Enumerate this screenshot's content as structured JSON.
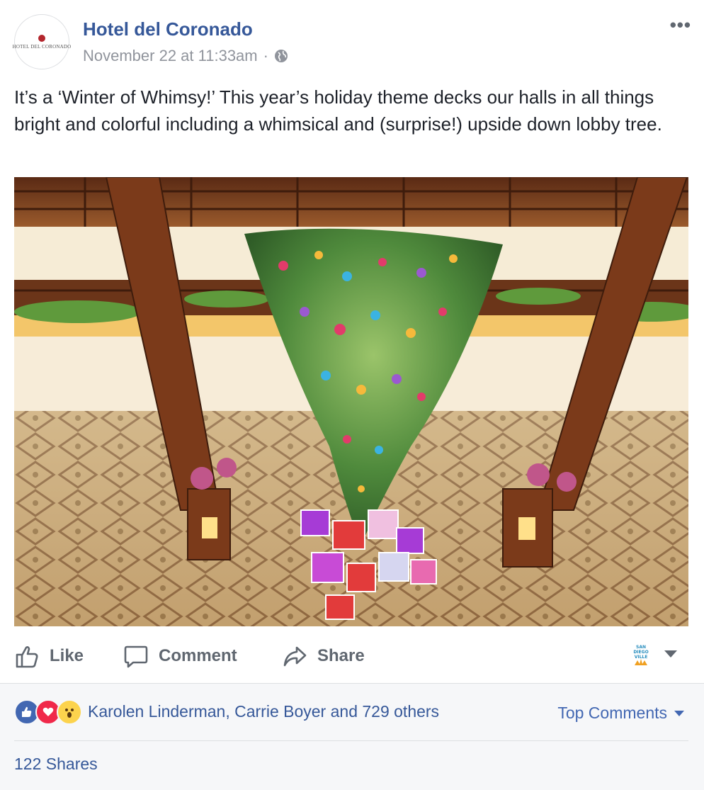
{
  "post": {
    "page_name": "Hotel del Coronado",
    "avatar_logo_text": "HOTEL DEL CORONADO",
    "timestamp": "November 22 at 11:33am",
    "separator": "·",
    "privacy_icon": "globe-icon",
    "more_label": "•••",
    "caption": "It’s a ‘Winter of Whimsy!’ This year’s holiday theme decks our halls in all things bright and colorful including a whimsical and (surprise!) upside down lobby tree."
  },
  "photo": {
    "description_icon": "photo"
  },
  "actions": {
    "like": "Like",
    "comment": "Comment",
    "share": "Share",
    "page_switcher_logo_text": "SAN DIEGO VILLE"
  },
  "footer": {
    "reactors": "Karolen Linderman, Carrie Boyer and 729 others",
    "top_comments": "Top Comments",
    "shares": "122 Shares"
  },
  "colors": {
    "link": "#365899",
    "muted": "#90949c",
    "like_blue": "#4267b2",
    "love_red": "#f0284a",
    "wow_yellow": "#fcd34d"
  }
}
